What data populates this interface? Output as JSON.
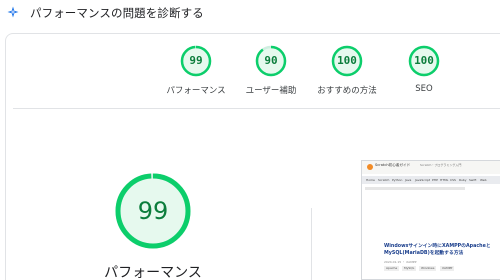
{
  "header": {
    "title": "パフォーマンスの問題を診断する",
    "icon": "diagnostic-sparkle-icon"
  },
  "colors": {
    "pass_green": "#0cce6b",
    "pass_green_text": "#0c7d3c",
    "pass_fill": "#e6f9ee",
    "track": "#e6f9ee"
  },
  "summary_gauges": [
    {
      "score": "99",
      "label": "パフォーマンス",
      "fraction": 0.99
    },
    {
      "score": "90",
      "label": "ユーザー補助",
      "fraction": 0.9
    },
    {
      "score": "100",
      "label": "おすすめの方法",
      "fraction": 1.0
    },
    {
      "score": "100",
      "label": "SEO",
      "fraction": 1.0
    }
  ],
  "main_gauge": {
    "score": "99",
    "label": "パフォーマンス",
    "fraction": 0.99
  },
  "screenshot": {
    "site_name": "Scratch初心者ガイド",
    "site_sub": "Scratch・プログラミング入門",
    "nav_items": [
      "Home",
      "Scratch",
      "Python",
      "Java",
      "JavaScript",
      "PHP",
      "HTML",
      "CSS",
      "Ruby",
      "Swift",
      "Web"
    ],
    "article_title": "Windowsサインイン時にXAMPPのApacheとMySQL(MariaDB)を起動する方法",
    "article_meta": "2024.01.15 ・ XAMPP",
    "tags": [
      "Apache",
      "MySQL",
      "Windows",
      "XAMPP"
    ]
  }
}
